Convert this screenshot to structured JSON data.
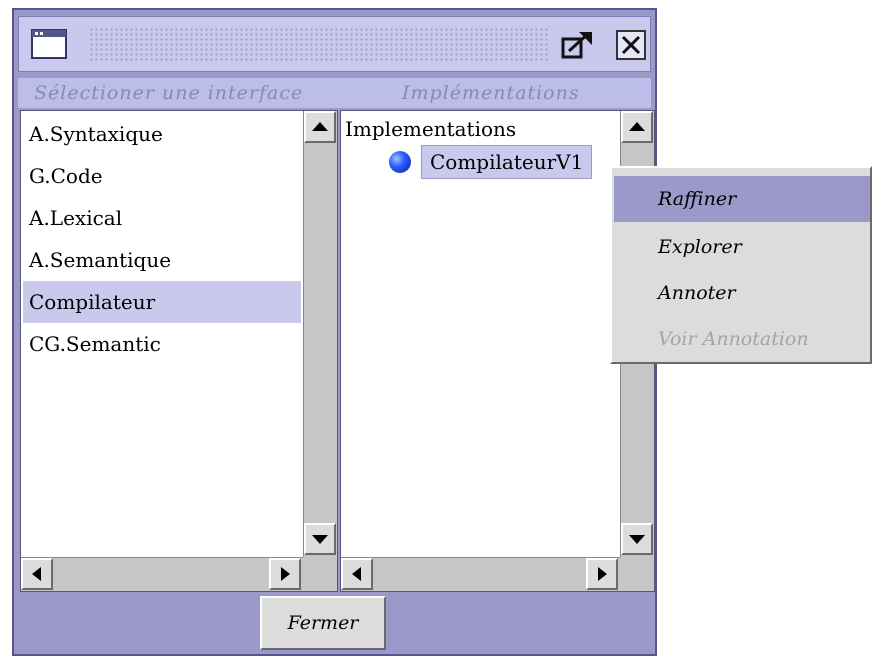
{
  "dialog": {
    "left_header": "Sélectioner une interface",
    "right_header": "Implémentations",
    "close_button_label": "Fermer"
  },
  "interfaces": [
    {
      "label": "A.Syntaxique",
      "selected": false
    },
    {
      "label": "G.Code",
      "selected": false
    },
    {
      "label": "A.Lexical",
      "selected": false
    },
    {
      "label": "A.Semantique",
      "selected": false
    },
    {
      "label": "Compilateur",
      "selected": true
    },
    {
      "label": "CG.Semantic",
      "selected": false
    }
  ],
  "tree": {
    "root": "Implementations",
    "node": "CompilateurV1"
  },
  "context_menu": {
    "items": [
      {
        "label": "Raffiner",
        "highlighted": true,
        "enabled": true
      },
      {
        "label": "Explorer",
        "highlighted": false,
        "enabled": true
      },
      {
        "label": "Annoter",
        "highlighted": false,
        "enabled": true
      },
      {
        "label": "Voir Annotation",
        "highlighted": false,
        "enabled": false
      }
    ]
  },
  "colors": {
    "frame": "#9a99c9",
    "selection": "#c9c9ee",
    "node_icon": "#2a5cff"
  },
  "icons": {
    "window": "window-icon",
    "maximize": "maximize-icon",
    "close": "close-icon",
    "scroll_up": "arrow-up-icon",
    "scroll_down": "arrow-down-icon",
    "scroll_left": "arrow-left-icon",
    "scroll_right": "arrow-right-icon",
    "tree_node": "blue-sphere-icon"
  }
}
